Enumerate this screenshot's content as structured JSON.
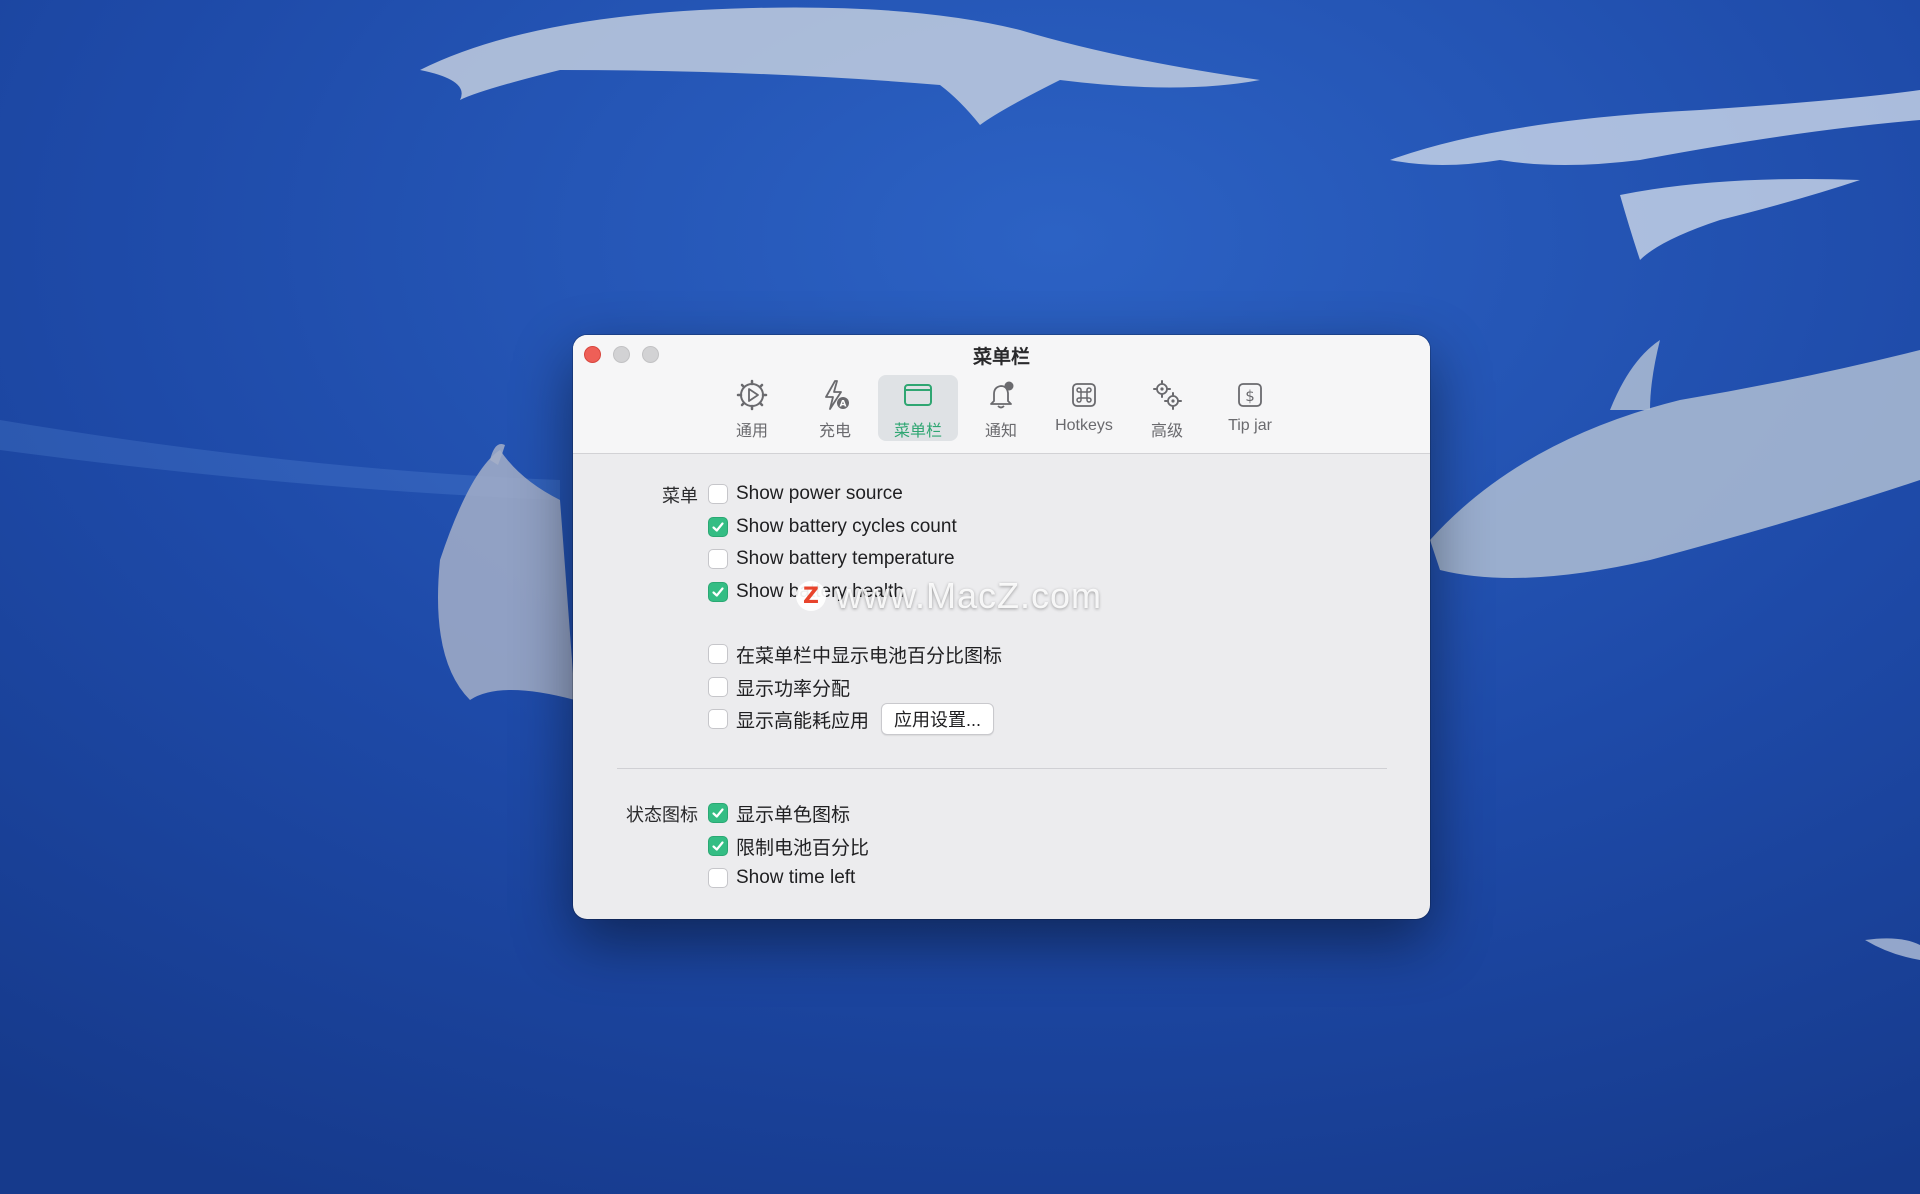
{
  "window": {
    "title": "菜单栏"
  },
  "toolbar": {
    "tabs": [
      {
        "id": "general",
        "label": "通用",
        "icon": "gear-play-icon",
        "active": false
      },
      {
        "id": "charging",
        "label": "充电",
        "icon": "bolt-auto-icon",
        "active": false
      },
      {
        "id": "menubar",
        "label": "菜单栏",
        "icon": "menubar-window-icon",
        "active": true
      },
      {
        "id": "notifications",
        "label": "通知",
        "icon": "bell-badge-icon",
        "active": false
      },
      {
        "id": "hotkeys",
        "label": "Hotkeys",
        "icon": "command-key-icon",
        "active": false
      },
      {
        "id": "advanced",
        "label": "高级",
        "icon": "gears-icon",
        "active": false
      },
      {
        "id": "tipjar",
        "label": "Tip jar",
        "icon": "dollar-icon",
        "active": false
      }
    ]
  },
  "menu_section": {
    "label": "菜单",
    "options": [
      {
        "label": "Show power source",
        "checked": false
      },
      {
        "label": "Show battery cycles count",
        "checked": true
      },
      {
        "label": "Show battery temperature",
        "checked": false
      },
      {
        "label": "Show battery health",
        "checked": true
      },
      {
        "label": "在菜单栏中显示电池百分比图标",
        "checked": false
      },
      {
        "label": "显示功率分配",
        "checked": false
      },
      {
        "label": "显示高能耗应用",
        "checked": false
      }
    ],
    "app_settings_button": "应用设置..."
  },
  "status_icon_section": {
    "label": "状态图标",
    "options": [
      {
        "label": "显示单色图标",
        "checked": true
      },
      {
        "label": "限制电池百分比",
        "checked": true
      },
      {
        "label": "Show time left",
        "checked": false
      }
    ]
  },
  "watermark": {
    "badge": "Z",
    "text": "www.MacZ.com"
  },
  "colors": {
    "accent": "#34bd84",
    "active_tab_text": "#2fa672",
    "close": "#ee5f57",
    "wallpaper": "#1e49a6"
  }
}
